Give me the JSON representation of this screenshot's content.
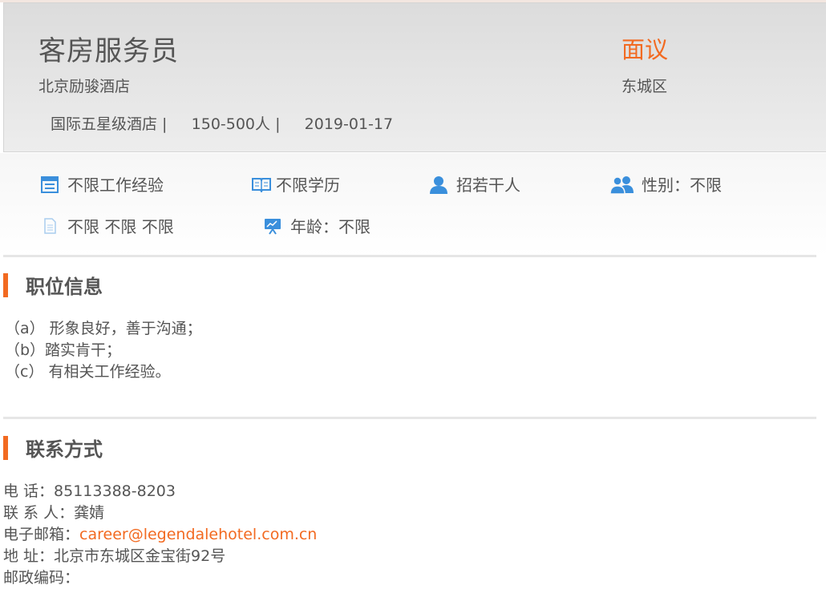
{
  "job": {
    "title": "客房服务员",
    "company": "北京励骏酒店",
    "meta": "国际五星级酒店 |     150-500人 |     2019-01-17",
    "salary": "面议",
    "district": "东城区"
  },
  "tags": {
    "experience": "不限工作经验",
    "education": "不限学历",
    "headcount": "招若干人",
    "gender": "性别：不限",
    "extra": "不限 不限 不限",
    "age": "年龄：不限"
  },
  "icons": {
    "experience": "calendar-icon",
    "education": "book-icon",
    "headcount": "person-icon",
    "gender": "people-icon",
    "extra": "document-icon",
    "age": "presentation-icon"
  },
  "colors": {
    "accent": "#f26a21",
    "icon_blue": "#3a8fdc"
  },
  "job_info": {
    "heading": "职位信息",
    "lines": [
      "（a） 形象良好，善于沟通；",
      "（b）踏实肯干；",
      "（c） 有相关工作经验。"
    ]
  },
  "contact": {
    "heading": "联系方式",
    "phone_label": "电 话：",
    "phone": "85113388-8203",
    "person_label": "联 系 人：",
    "person": "龚婧",
    "email_label": "电子邮箱：",
    "email": "career@legendalehotel.com.cn",
    "address_label": "地 址：",
    "address": "北京市东城区金宝街92号",
    "postcode_label": "邮政编码："
  }
}
